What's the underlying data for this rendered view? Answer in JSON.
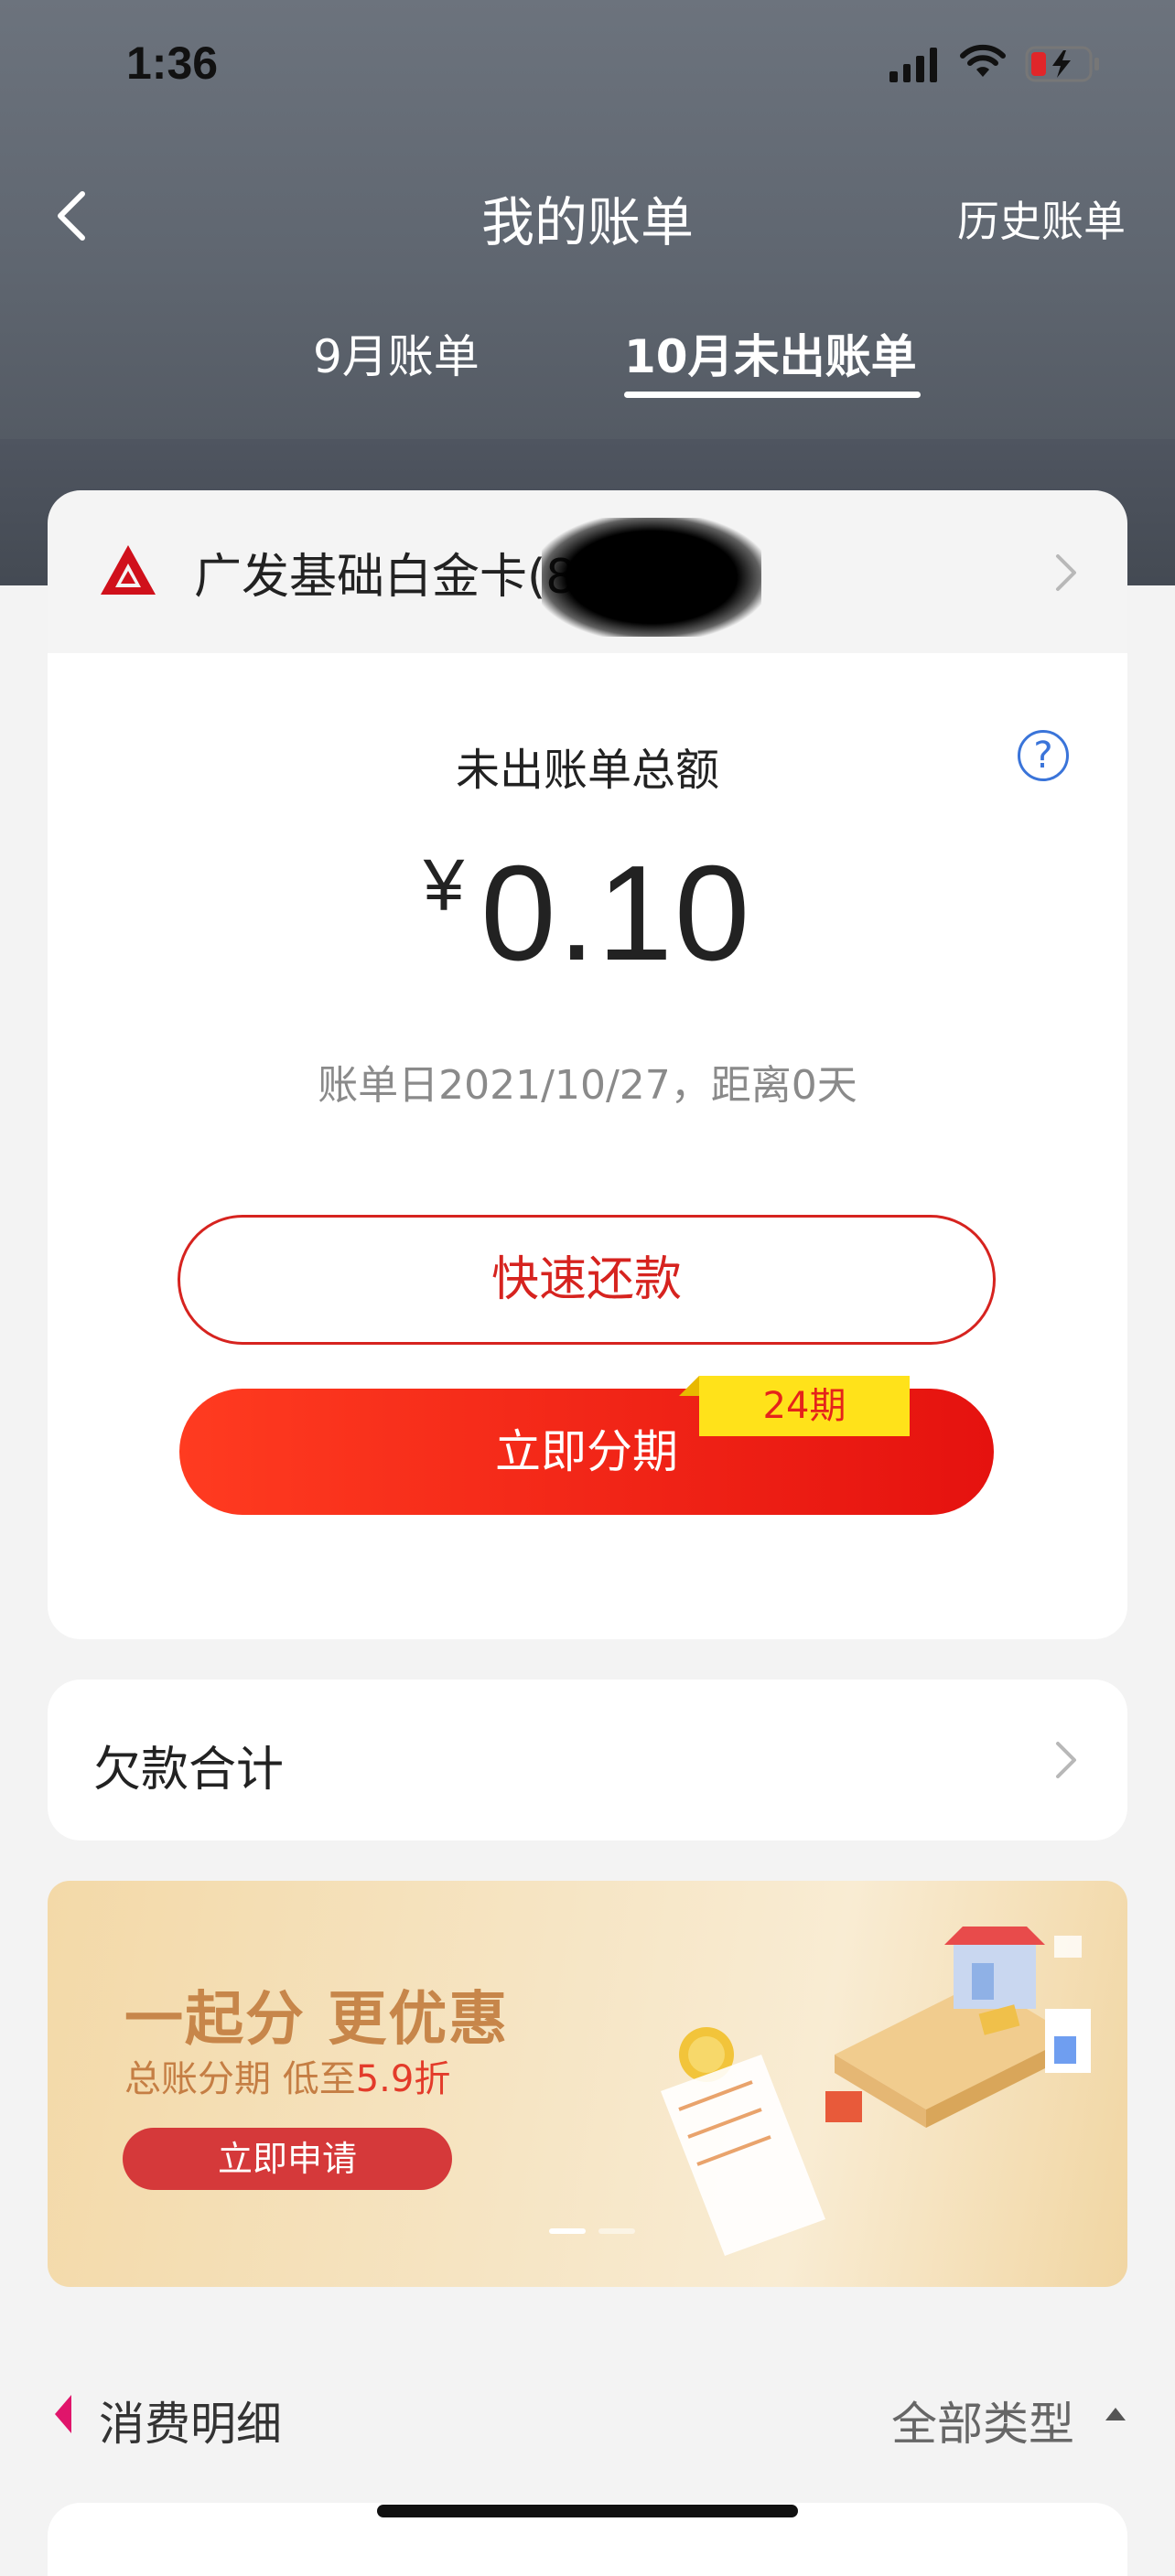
{
  "status_bar": {
    "time": "1:36"
  },
  "header": {
    "title": "我的账单",
    "history_link": "历史账单",
    "tabs": [
      {
        "label": "9月账单",
        "active": false
      },
      {
        "label": "10月未出账单",
        "active": true
      }
    ]
  },
  "card": {
    "name": "广发基础白金卡(8"
  },
  "bill": {
    "label": "未出账单总额",
    "currency": "¥",
    "amount": "0.10",
    "date_text": "账单日2021/10/27，距离0天",
    "repay_button": "快速还款",
    "installment_button": "立即分期",
    "installment_badge": "24期"
  },
  "debt": {
    "label": "欠款合计"
  },
  "banner": {
    "title": "一起分 更优惠",
    "subtitle_prefix": "总账分期 低至",
    "subtitle_highlight": "5.9折",
    "button": "立即申请",
    "active_slide": 1,
    "slide_count": 2
  },
  "details": {
    "title": "消费明细",
    "filter": "全部类型"
  },
  "colors": {
    "brand_red": "#d6231f",
    "accent_blue": "#3a74d9",
    "badge_yellow": "#ffe21a",
    "marker_magenta": "#e0156b"
  }
}
